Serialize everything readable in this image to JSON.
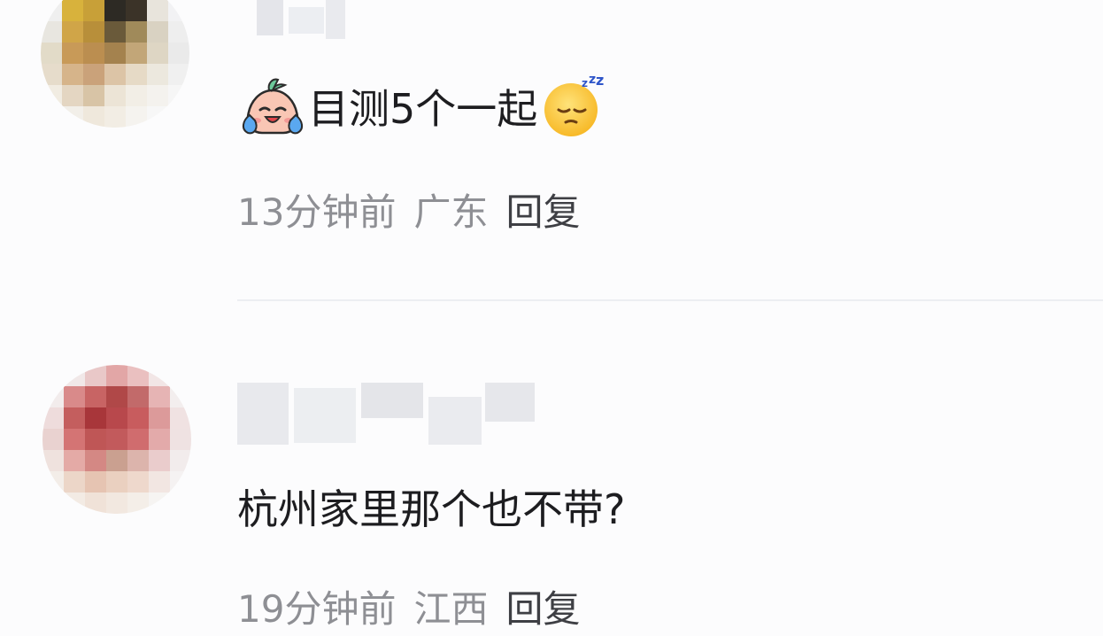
{
  "comments": [
    {
      "content": "目测5个一起",
      "time": "13分钟前",
      "location": "广东",
      "reply_label": "回复",
      "emoji_before": "crying-laughing-peach-icon",
      "emoji_after": "sleeping-face-icon"
    },
    {
      "content": "杭州家里那个也不带?",
      "time": "19分钟前",
      "location": "江西",
      "reply_label": "回复"
    }
  ],
  "colors": {
    "text": "#1d1d20",
    "meta": "#8e8f94",
    "reply": "#3e3f44",
    "divider": "#eceef2"
  }
}
